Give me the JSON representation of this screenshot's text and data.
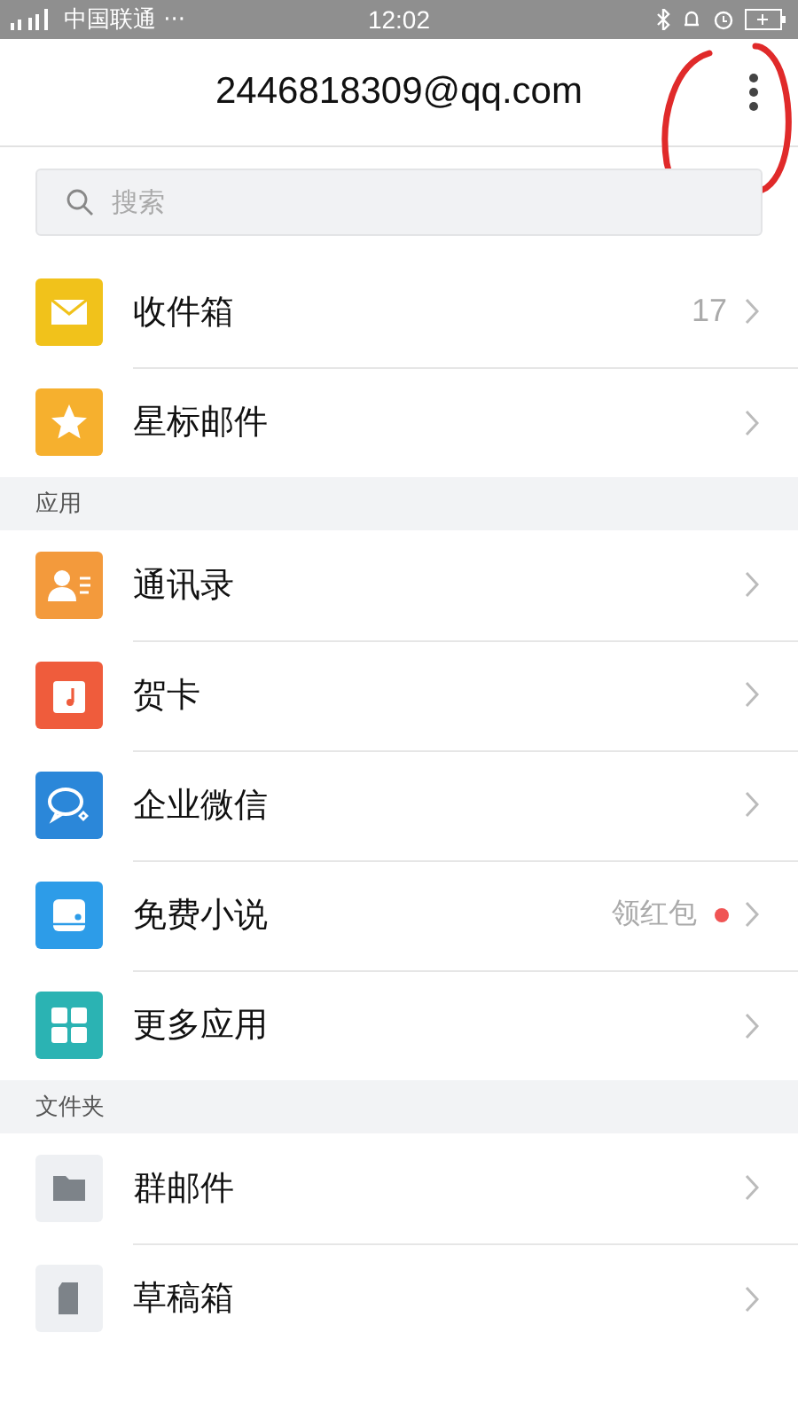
{
  "status_bar": {
    "carrier": "中国联通 ···",
    "time": "12:02"
  },
  "header": {
    "title": "2446818309@qq.com"
  },
  "search": {
    "placeholder": "搜索"
  },
  "sections": [
    {
      "items": [
        {
          "label": "收件箱",
          "count": "17"
        },
        {
          "label": "星标邮件"
        }
      ]
    },
    {
      "title": "应用",
      "items": [
        {
          "label": "通讯录"
        },
        {
          "label": "贺卡"
        },
        {
          "label": "企业微信"
        },
        {
          "label": "免费小说",
          "note": "领红包",
          "dot": true
        },
        {
          "label": "更多应用"
        }
      ]
    },
    {
      "title": "文件夹",
      "items": [
        {
          "label": "群邮件"
        },
        {
          "label": "草稿箱"
        }
      ]
    }
  ],
  "annotation": {
    "kind": "circle"
  }
}
